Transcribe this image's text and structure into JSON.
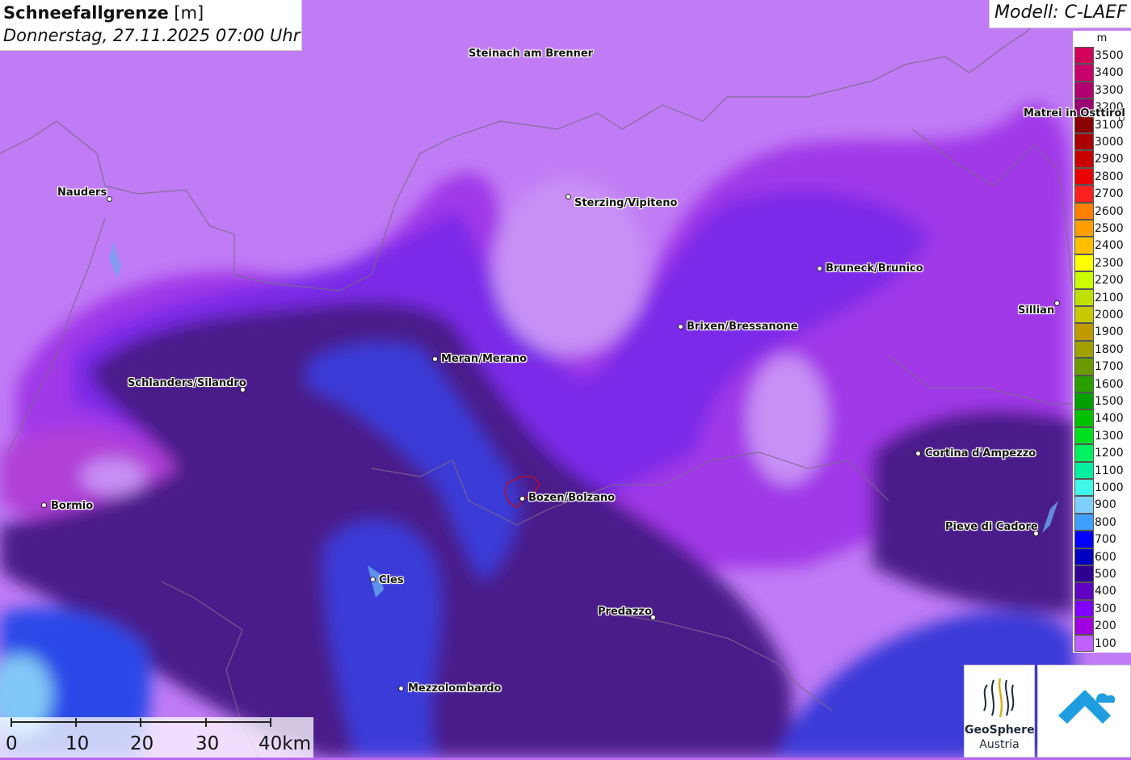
{
  "header": {
    "title": "Schneefallgrenze",
    "unit": "[m]",
    "datetime": "Donnerstag, 27.11.2025 07:00 Uhr",
    "model": "Modell: C-LAEF"
  },
  "legend": {
    "unit": "m",
    "entries": [
      {
        "label": "3500",
        "color": "#d1005a"
      },
      {
        "label": "3400",
        "color": "#c8006a"
      },
      {
        "label": "3300",
        "color": "#b30070"
      },
      {
        "label": "3200",
        "color": "#9a0070"
      },
      {
        "label": "3100",
        "color": "#8a0000"
      },
      {
        "label": "3000",
        "color": "#a80000"
      },
      {
        "label": "2900",
        "color": "#c80000"
      },
      {
        "label": "2800",
        "color": "#e80000"
      },
      {
        "label": "2700",
        "color": "#ff2020"
      },
      {
        "label": "2600",
        "color": "#ff8000"
      },
      {
        "label": "2500",
        "color": "#ffa000"
      },
      {
        "label": "2400",
        "color": "#ffc000"
      },
      {
        "label": "2300",
        "color": "#ffff00"
      },
      {
        "label": "2200",
        "color": "#ccff00"
      },
      {
        "label": "2100",
        "color": "#bfe000"
      },
      {
        "label": "2000",
        "color": "#c8c800"
      },
      {
        "label": "1900",
        "color": "#c09a00"
      },
      {
        "label": "1800",
        "color": "#a0a000"
      },
      {
        "label": "1700",
        "color": "#6a9a00"
      },
      {
        "label": "1600",
        "color": "#2aa000"
      },
      {
        "label": "1500",
        "color": "#00a000"
      },
      {
        "label": "1400",
        "color": "#00c000"
      },
      {
        "label": "1300",
        "color": "#00e020"
      },
      {
        "label": "1200",
        "color": "#00f060"
      },
      {
        "label": "1100",
        "color": "#00f0a0"
      },
      {
        "label": "1000",
        "color": "#40f8e8"
      },
      {
        "label": "900",
        "color": "#80d0ff"
      },
      {
        "label": "800",
        "color": "#40a0ff"
      },
      {
        "label": "700",
        "color": "#0000ff"
      },
      {
        "label": "600",
        "color": "#0000c0"
      },
      {
        "label": "500",
        "color": "#300090"
      },
      {
        "label": "400",
        "color": "#6000c0"
      },
      {
        "label": "300",
        "color": "#8000ff"
      },
      {
        "label": "200",
        "color": "#a000e0"
      },
      {
        "label": "100",
        "color": "#c060ff"
      }
    ]
  },
  "places": [
    {
      "name": "Steinach am Brenner"
    },
    {
      "name": "Nauders"
    },
    {
      "name": "Sterzing/Vipiteno"
    },
    {
      "name": "Bruneck/Brunico"
    },
    {
      "name": "Matrei in Osttirol"
    },
    {
      "name": "Sillian"
    },
    {
      "name": "Brixen/Bressanone"
    },
    {
      "name": "Meran/Merano"
    },
    {
      "name": "Schlanders/Silandro"
    },
    {
      "name": "Cortina d'Ampezzo"
    },
    {
      "name": "Bormio"
    },
    {
      "name": "Bozen/Bolzano"
    },
    {
      "name": "Pieve di Cadore"
    },
    {
      "name": "Cles"
    },
    {
      "name": "Predazzo"
    },
    {
      "name": "Mezzolombardo"
    }
  ],
  "scale": {
    "labels": [
      "0",
      "10",
      "20",
      "30",
      "40km"
    ]
  },
  "logos": {
    "org_name": "GeoSphere",
    "org_country": "Austria"
  }
}
